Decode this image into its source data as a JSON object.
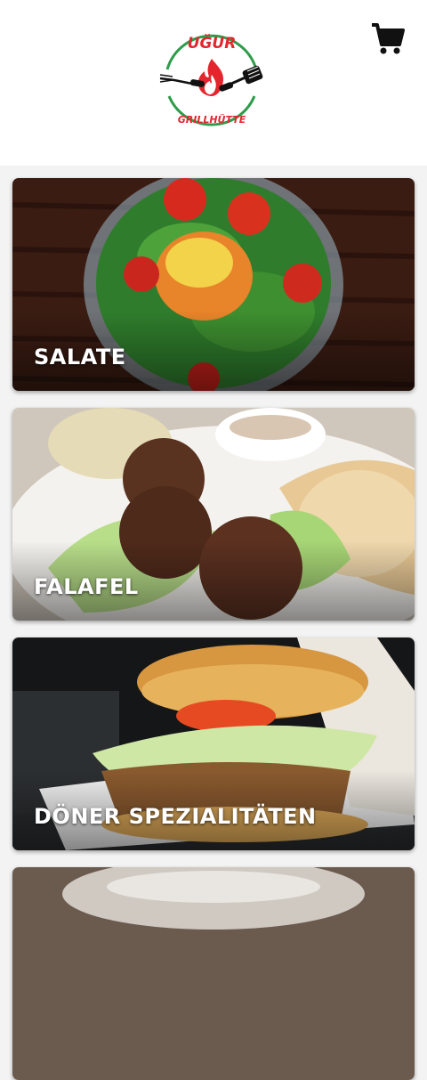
{
  "header": {
    "logo": {
      "top_text": "UĞUR",
      "bottom_text": "GRILLHÜTTE"
    },
    "cart_icon": "shopping-cart-icon"
  },
  "categories": [
    {
      "label": "SALATE"
    },
    {
      "label": "FALAFEL"
    },
    {
      "label": "DÖNER SPEZIALITÄTEN"
    },
    {
      "label": ""
    }
  ],
  "colors": {
    "brand_red": "#e3262e",
    "brand_green": "#2e9c4a",
    "text_white": "#ffffff"
  }
}
